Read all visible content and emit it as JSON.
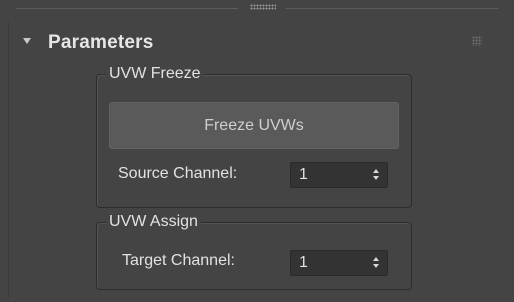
{
  "rollout": {
    "title": "Parameters",
    "collapse_icon": "chevron-down-icon",
    "grip_icon": "grip-dots-icon"
  },
  "uvw_freeze": {
    "group_label": "UVW Freeze",
    "freeze_button_label": "Freeze UVWs",
    "source_channel_label": "Source Channel:",
    "source_channel_value": "1"
  },
  "uvw_assign": {
    "group_label": "UVW Assign",
    "target_channel_label": "Target Channel:",
    "target_channel_value": "1"
  }
}
